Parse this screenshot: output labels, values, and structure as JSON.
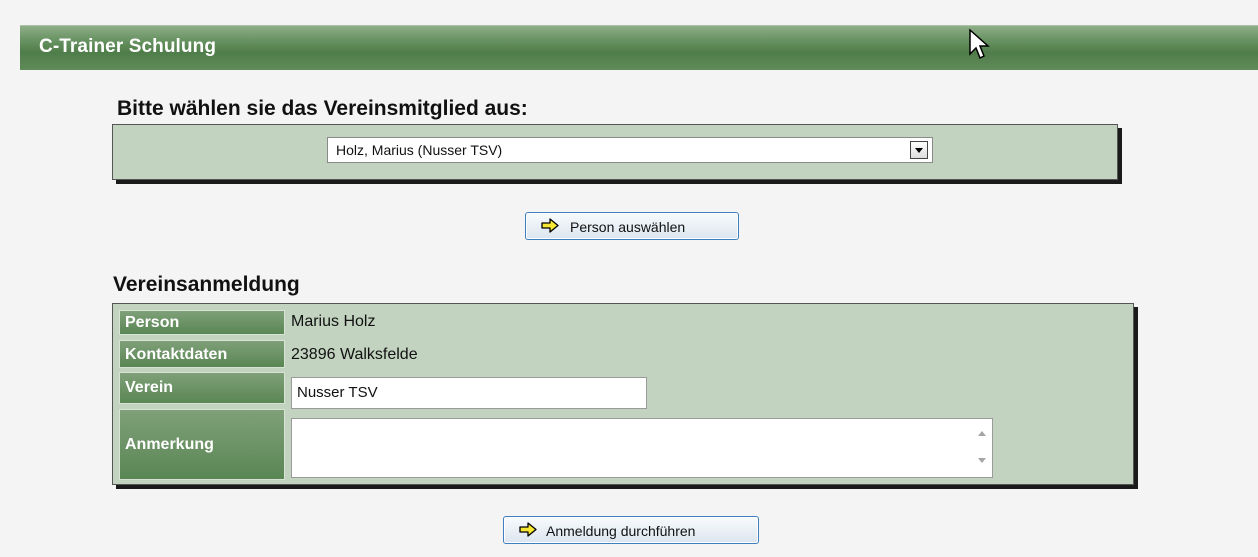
{
  "header": {
    "title": "C-Trainer Schulung"
  },
  "member_select": {
    "heading": "Bitte wählen sie das Vereinsmitglied aus:",
    "selected": "Holz, Marius (Nusser TSV)",
    "button_label": "Person auswählen"
  },
  "registration": {
    "heading": "Vereinsanmeldung",
    "person_label": "Person",
    "person_value": "Marius Holz",
    "contact_label": "Kontaktdaten",
    "contact_value": "23896 Walksfelde",
    "club_label": "Verein",
    "club_value": "Nusser TSV",
    "note_label": "Anmerkung",
    "note_value": "",
    "submit_label": "Anmeldung durchführen"
  },
  "icons": {
    "button_icon": "arrow-right-icon",
    "cursor": "mouse-pointer-icon"
  },
  "colors": {
    "header_green": "#5f8b59",
    "panel_bg": "#c2d3c0",
    "label_green": "#6a9464",
    "button_border": "#3f7fbf"
  }
}
